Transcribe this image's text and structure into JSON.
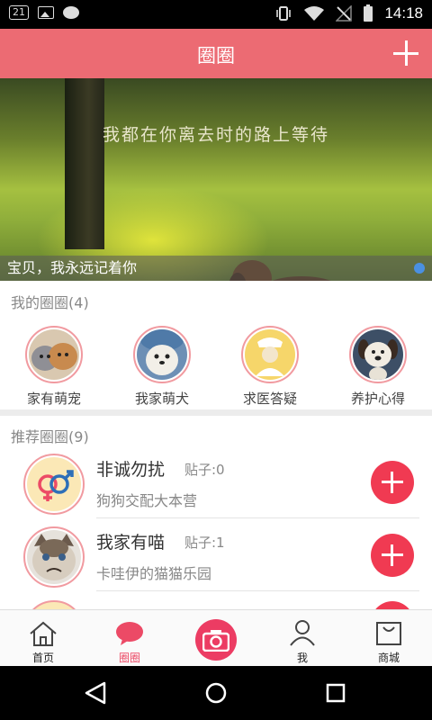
{
  "status_bar": {
    "badge": "21",
    "time": "14:18"
  },
  "header": {
    "title": "圈圈"
  },
  "banner": {
    "slogan": "我都在你离去时的路上等待",
    "caption": "宝贝，我永远记着你"
  },
  "my_circles": {
    "title": "我的圈圈",
    "count": "(4)",
    "items": [
      {
        "label": "家有萌宠",
        "icon": "cat-dog-avatar"
      },
      {
        "label": "我家萌犬",
        "icon": "dog-costume-avatar"
      },
      {
        "label": "求医答疑",
        "icon": "nurse-avatar"
      },
      {
        "label": "养护心得",
        "icon": "cartoon-dog-avatar"
      }
    ]
  },
  "recommend": {
    "title": "推荐圈圈",
    "count": "(9)",
    "items": [
      {
        "name": "非诚勿扰",
        "posts": "贴子:0",
        "desc": "狗狗交配大本营",
        "icon": "gender-symbols-avatar"
      },
      {
        "name": "我家有喵",
        "posts": "贴子:1",
        "desc": "卡哇伊的猫猫乐园",
        "icon": "grumpy-cat-avatar"
      }
    ]
  },
  "bottom_nav": [
    {
      "label": "首页",
      "icon": "home-icon",
      "active": false
    },
    {
      "label": "圈圈",
      "icon": "chat-bubble-icon",
      "active": true
    },
    {
      "label": "",
      "icon": "camera-icon",
      "active": false
    },
    {
      "label": "我",
      "icon": "person-icon",
      "active": false
    },
    {
      "label": "商城",
      "icon": "shopping-bag-icon",
      "active": false
    }
  ],
  "colors": {
    "header": "#ec6b73",
    "accent": "#f03a52",
    "ring": "#f19aa0"
  }
}
